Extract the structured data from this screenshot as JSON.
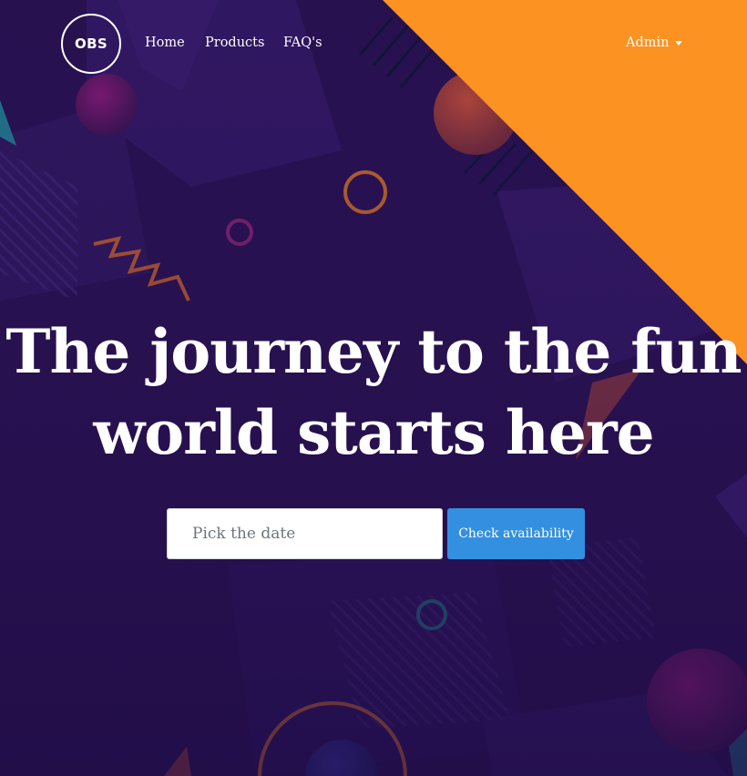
{
  "colors": {
    "background": "#26104f",
    "accent_orange": "#fb9222",
    "button_blue": "#338fe0",
    "text": "#ffffff"
  },
  "nav": {
    "logo_text": "OBS",
    "links": [
      {
        "label": "Home"
      },
      {
        "label": "Products"
      },
      {
        "label": "FAQ's"
      }
    ],
    "admin_label": "Admin",
    "admin_icon": "caret-down-icon"
  },
  "hero": {
    "title": "The journey to the fun world starts here",
    "date_placeholder": "Pick the date",
    "date_value": "",
    "check_button_label": "Check availability"
  }
}
